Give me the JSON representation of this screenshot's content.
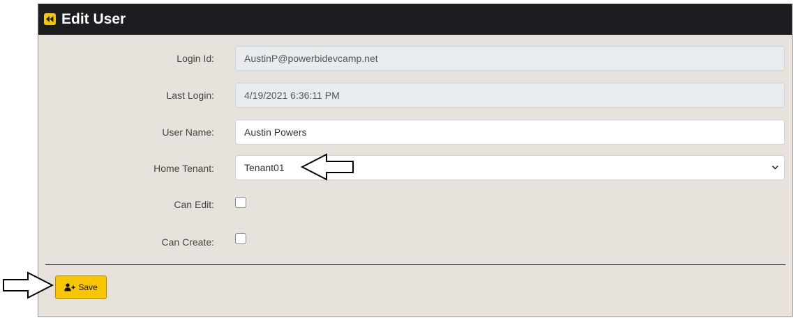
{
  "header": {
    "title": "Edit User",
    "icon": "fast-backward-icon"
  },
  "form": {
    "login_id": {
      "label": "Login Id:",
      "value": "AustinP@powerbidevcamp.net"
    },
    "last_login": {
      "label": "Last Login:",
      "value": "4/19/2021 6:36:11 PM"
    },
    "user_name": {
      "label": "User Name:",
      "value": "Austin Powers"
    },
    "home_tenant": {
      "label": "Home Tenant:",
      "value": "Tenant01"
    },
    "can_edit": {
      "label": "Can Edit:",
      "checked": false
    },
    "can_create": {
      "label": "Can Create:",
      "checked": false
    }
  },
  "actions": {
    "save_label": "Save",
    "save_icon": "user-plus-icon"
  },
  "colors": {
    "header_bg": "#1b1d20",
    "panel_bg": "#e7e2dc",
    "accent": "#f7c600",
    "readonly_bg": "#e9ecef"
  }
}
